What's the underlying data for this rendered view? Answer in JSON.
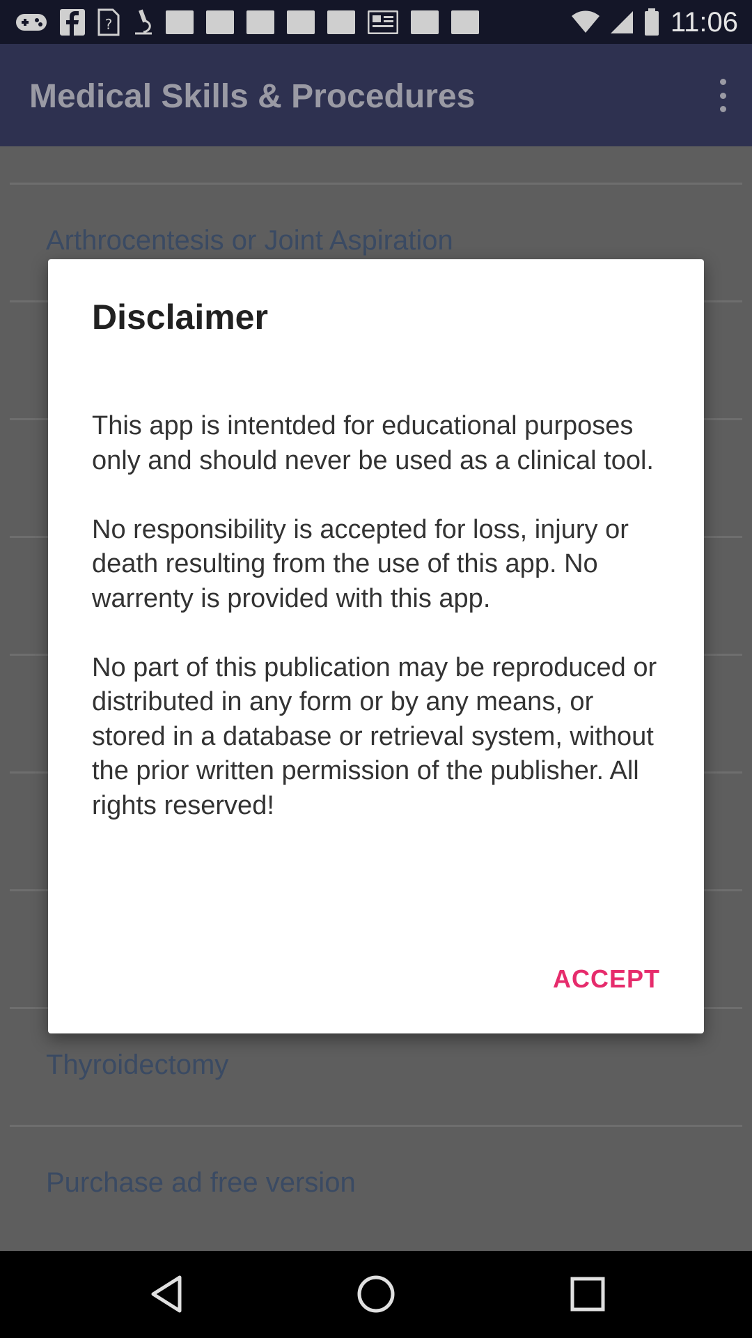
{
  "status_bar": {
    "time": "11:06",
    "left_icons": [
      "gamepad-icon",
      "facebook-icon",
      "unknown-file-icon",
      "microscope-icon",
      "notification-icon",
      "notification-icon",
      "notification-icon",
      "notification-icon",
      "notification-icon",
      "newspaper-icon",
      "notification-icon",
      "notification-icon"
    ]
  },
  "app_bar": {
    "title": "Medical Skills & Procedures"
  },
  "list": {
    "items": [
      "Arthrocentesis or Joint Aspiration",
      "",
      "",
      "",
      "",
      "",
      "",
      "Thyroidectomy",
      "Purchase ad free version"
    ]
  },
  "dialog": {
    "title": "Disclaimer",
    "body": "This app is intentded for educational purposes only and should never be used as a clinical tool.\n\nNo responsibility is accepted for loss, injury or death resulting from the use of this app. No warrenty is provided with this app.\n\nNo part of this publication may be reproduced or distributed in any form or by any means, or stored in a database or retrieval system, without the prior written permission of the publisher. All rights reserved!",
    "accept_label": "ACCEPT"
  },
  "colors": {
    "accent": "#e62c6c",
    "app_bar": "#2e3150",
    "status_bar": "#141628"
  }
}
